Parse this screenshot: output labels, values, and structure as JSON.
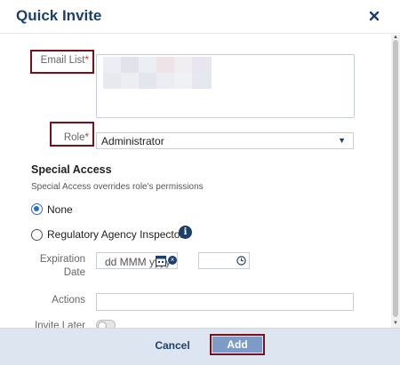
{
  "dialog": {
    "title": "Quick Invite",
    "close_icon": "close-x-icon"
  },
  "form": {
    "email_label": "Email List",
    "required_mark": "*",
    "role_label": "Role",
    "role_value": "Administrator",
    "special_access": {
      "title": "Special Access",
      "subtitle": "Special Access overrides role's permissions",
      "options": [
        {
          "label": "None",
          "selected": true
        },
        {
          "label": "Regulatory Agency Inspector",
          "selected": false
        }
      ]
    },
    "expiration_label_line1": "Expiration",
    "expiration_label_line2": "Date",
    "date_placeholder": "dd MMM yyyy",
    "actions_label": "Actions",
    "invite_later_label": "Invite Later",
    "invite_later_on": false
  },
  "footer": {
    "cancel_label": "Cancel",
    "add_label": "Add"
  },
  "colors": {
    "brand_navy": "#1d3f6b",
    "highlight": "#7a0f1e",
    "required": "#c0392b",
    "footer_bg": "#dde5f1",
    "add_button": "#7c9cc7"
  }
}
